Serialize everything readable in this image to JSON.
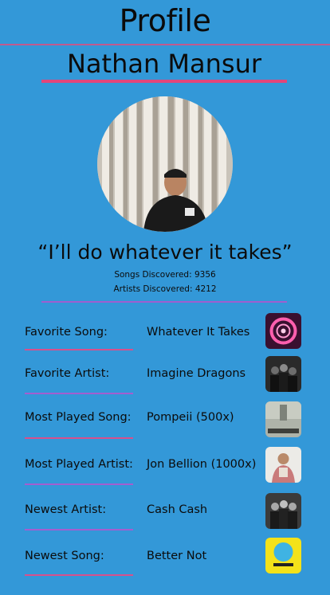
{
  "header": {
    "title": "Profile"
  },
  "profile": {
    "name": "Nathan Mansur",
    "quote": "“I’ll do whatever it takes”",
    "songs_discovered": "Songs Discovered: 9356",
    "artists_discovered": "Artists Discovered: 4212"
  },
  "stats": [
    {
      "label": "Favorite Song:",
      "value": "Whatever It Takes",
      "art": "circular-neon-artwork"
    },
    {
      "label": "Favorite Artist:",
      "value": "Imagine Dragons",
      "art": "band-photo-artwork"
    },
    {
      "label": "Most Played Song:",
      "value": "Pompeii (500x)",
      "art": "bastille-artwork"
    },
    {
      "label": "Most Played Artist:",
      "value": "Jon Bellion (1000x)",
      "art": "portrait-artwork"
    },
    {
      "label": "Newest Artist:",
      "value": "Cash Cash",
      "art": "trio-photo-artwork"
    },
    {
      "label": "Newest Song:",
      "value": "Better Not",
      "art": "yellow-pop-artwork"
    }
  ],
  "colors": {
    "background": "#3398d8",
    "header_line": "#c25a8e",
    "name_underline": "#e2467a",
    "divider": "#9f5fd0"
  }
}
